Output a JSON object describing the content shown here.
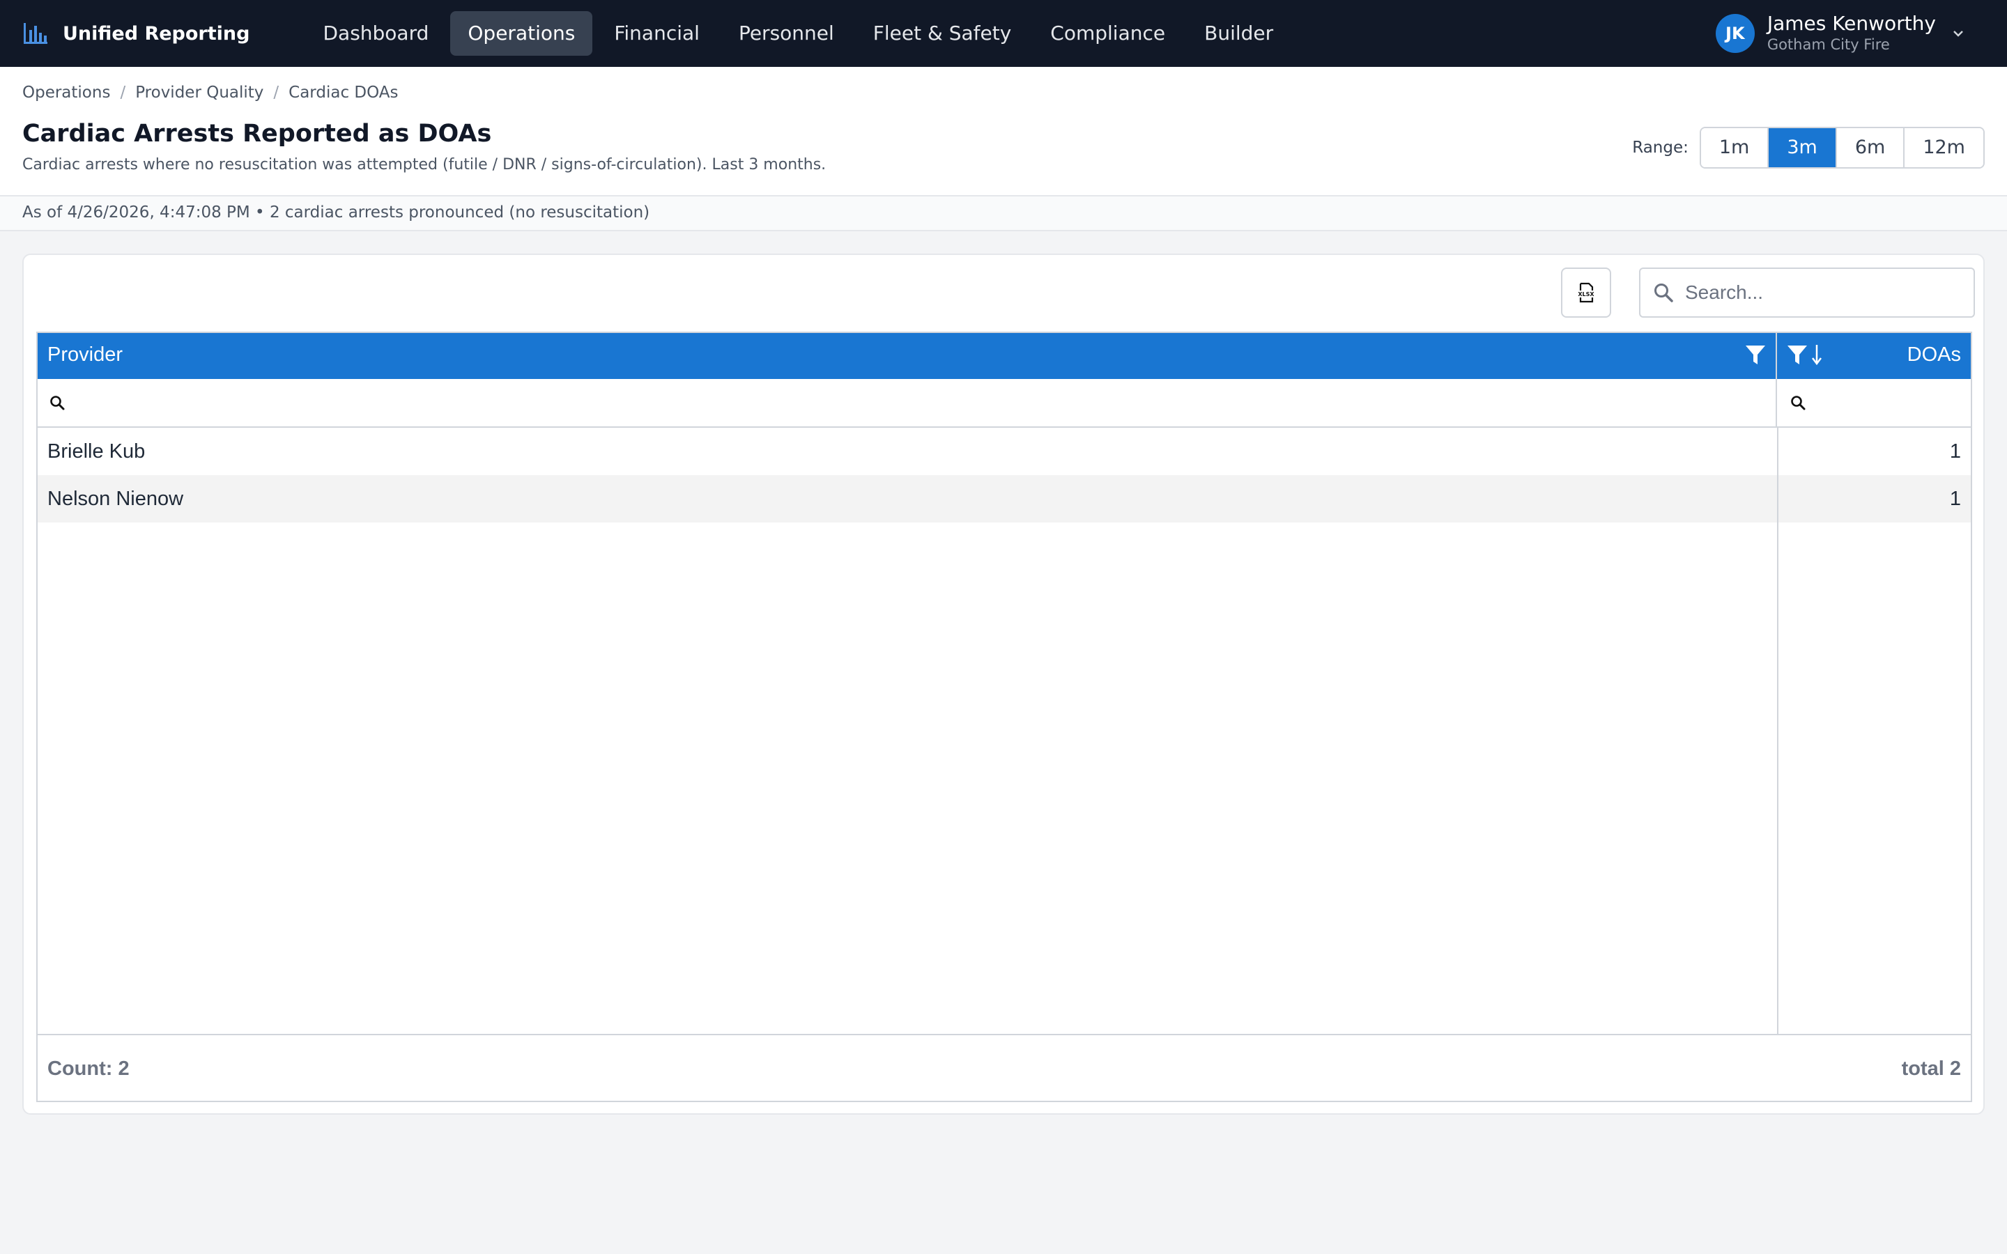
{
  "app": {
    "brand": "Unified Reporting"
  },
  "nav": {
    "items": [
      {
        "label": "Dashboard",
        "active": false
      },
      {
        "label": "Operations",
        "active": true
      },
      {
        "label": "Financial",
        "active": false
      },
      {
        "label": "Personnel",
        "active": false
      },
      {
        "label": "Fleet & Safety",
        "active": false
      },
      {
        "label": "Compliance",
        "active": false
      },
      {
        "label": "Builder",
        "active": false
      }
    ]
  },
  "user": {
    "initials": "JK",
    "name": "James Kenworthy",
    "org": "Gotham City Fire"
  },
  "breadcrumb": [
    "Operations",
    "Provider Quality",
    "Cardiac DOAs"
  ],
  "page": {
    "title": "Cardiac Arrests Reported as DOAs",
    "subtitle": "Cardiac arrests where no resuscitation was attempted (futile / DNR / signs-of-circulation). Last 3 months."
  },
  "range": {
    "label": "Range:",
    "options": [
      "1m",
      "3m",
      "6m",
      "12m"
    ],
    "selected": "3m"
  },
  "status": {
    "text": "As of 4/26/2026, 4:47:08 PM • 2 cardiac arrests pronounced (no resuscitation)"
  },
  "toolbar": {
    "export_icon": "xlsx-export-icon",
    "search_placeholder": "Search..."
  },
  "table": {
    "columns": [
      "Provider",
      "DOAs"
    ],
    "rows": [
      {
        "provider": "Brielle Kub",
        "doas": "1"
      },
      {
        "provider": "Nelson Nienow",
        "doas": "1"
      }
    ],
    "footer": {
      "count": "Count: 2",
      "total": "total 2"
    }
  },
  "colors": {
    "nav_bg": "#111827",
    "accent": "#1976d2",
    "page_bg": "#f3f4f6"
  }
}
